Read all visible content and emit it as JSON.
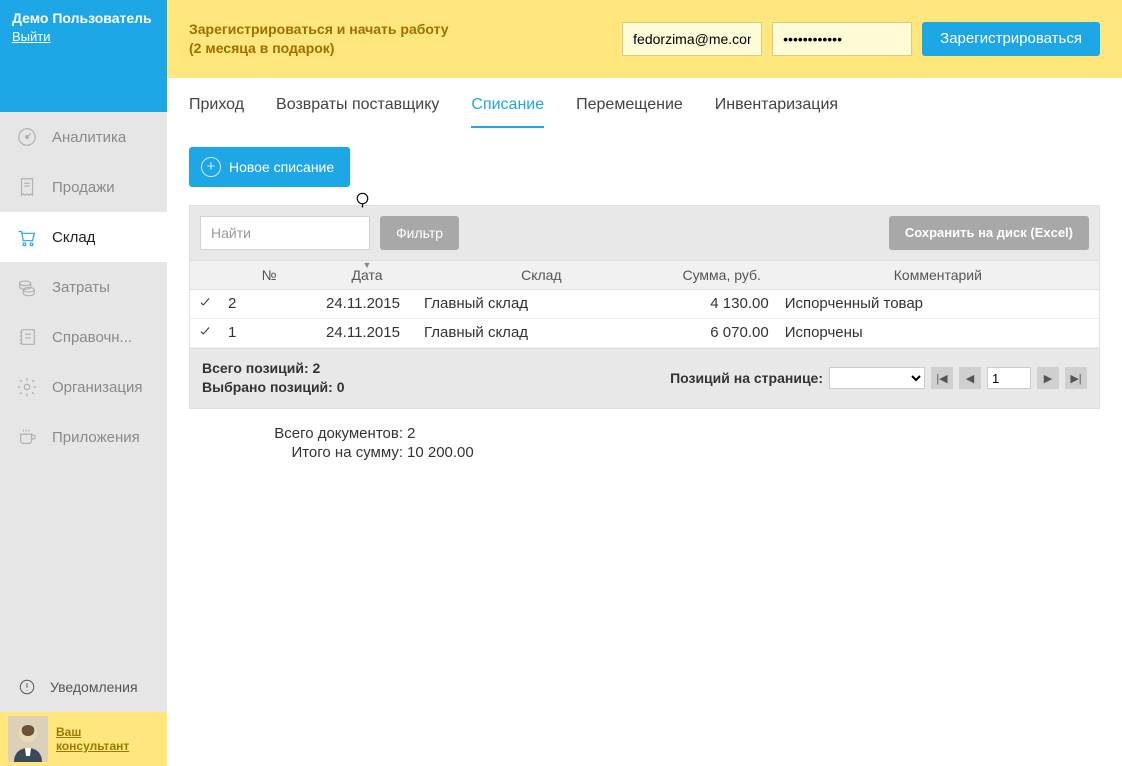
{
  "user": {
    "name": "Демо Пользователь",
    "logout": "Выйти"
  },
  "sidebar": {
    "items": [
      {
        "label": "Аналитика"
      },
      {
        "label": "Продажи"
      },
      {
        "label": "Склад"
      },
      {
        "label": "Затраты"
      },
      {
        "label": "Справочн..."
      },
      {
        "label": "Организация"
      },
      {
        "label": "Приложения"
      }
    ],
    "notifications": "Уведомления",
    "consultant_l1": "Ваш",
    "consultant_l2": "консультант"
  },
  "ribbon": {
    "line1": "Зарегистрироваться и начать работу",
    "line2": "(2 месяца в подарок)",
    "email": "fedorzima@me.con",
    "password": "••••••••••••",
    "register": "Зарегистрироваться"
  },
  "tabs": [
    {
      "label": "Приход"
    },
    {
      "label": "Возвраты поставщику"
    },
    {
      "label": "Списание",
      "active": true
    },
    {
      "label": "Перемещение"
    },
    {
      "label": "Инвентаризация"
    }
  ],
  "actions": {
    "new_writeoff": "Новое списание"
  },
  "filter": {
    "search_placeholder": "Найти",
    "filter_btn": "Фильтр",
    "save_excel": "Сохранить на диск (Excel)"
  },
  "grid": {
    "headers": {
      "num": "№",
      "date": "Дата",
      "warehouse": "Склад",
      "sum": "Сумма, руб.",
      "comment": "Комментарий"
    },
    "rows": [
      {
        "num": "2",
        "date": "24.11.2015",
        "warehouse": "Главный склад",
        "sum": "4 130.00",
        "comment": "Испорченный товар"
      },
      {
        "num": "1",
        "date": "24.11.2015",
        "warehouse": "Главный склад",
        "sum": "6 070.00",
        "comment": "Испорчены"
      }
    ]
  },
  "footer": {
    "total_positions_label": "Всего позиций:",
    "total_positions": "2",
    "selected_label": "Выбрано позиций:",
    "selected": "0",
    "per_page_label": "Позиций на странице:",
    "page_value": "1"
  },
  "totals": {
    "docs_label": "Всего документов:",
    "docs": "2",
    "sum_label": "Итого на сумму:",
    "sum": "10 200.00"
  }
}
